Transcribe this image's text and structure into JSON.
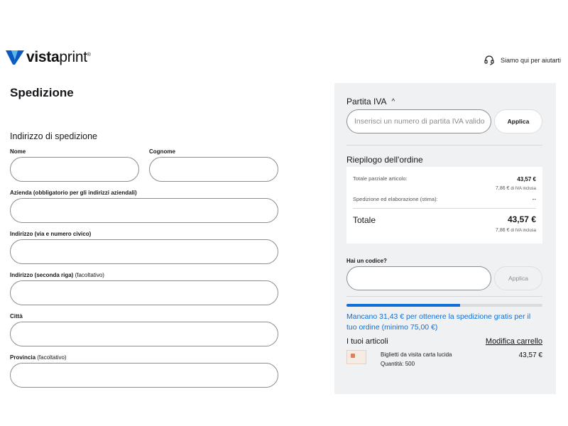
{
  "header": {
    "logo_bold": "vista",
    "logo_light": "print",
    "logo_reg": "®",
    "help_text": "Siamo qui per aiutarti",
    "colors": {
      "logo_blue": "#0a58c2",
      "logo_light_blue": "#58b6e8"
    }
  },
  "shipping": {
    "title": "Spedizione",
    "subhead": "Indirizzo di spedizione",
    "fields": {
      "first_name": {
        "label": "Nome",
        "value": ""
      },
      "last_name": {
        "label": "Cognome",
        "value": ""
      },
      "company": {
        "label": "Azienda (obbligatorio per gli indirizzi aziendali)",
        "value": ""
      },
      "address1": {
        "label": "Indirizzo (via e numero civico)",
        "value": ""
      },
      "address2": {
        "label": "Indirizzo (seconda riga)",
        "optional": "(facoltativo)",
        "value": ""
      },
      "city": {
        "label": "Città",
        "value": ""
      },
      "province": {
        "label": "Provincia",
        "optional": "(facoltativo)",
        "value": ""
      }
    }
  },
  "sidebar": {
    "vat": {
      "title": "Partita IVA",
      "caret": "^",
      "placeholder": "Inserisci un numero di partita IVA valido",
      "apply": "Applica"
    },
    "summary": {
      "title": "Riepilogo dell'ordine",
      "subtotal_label": "Totale parziale articolo:",
      "subtotal_value": "43,57 €",
      "subtotal_vat": "7,86 €",
      "vat_included": "di IVA inclusa",
      "shipping_label": "Spedizione ed elaborazione (stima):",
      "shipping_value": "--",
      "total_label": "Totale",
      "total_value": "43,57 €",
      "total_vat": "7,86 €"
    },
    "promo": {
      "label": "Hai un codice?",
      "value": "",
      "apply": "Applica"
    },
    "free_shipping": {
      "progress": 0.58,
      "message": "Mancano 31,43 € per ottenere la spedizione gratis per il tuo ordine (minimo 75,00 €)",
      "color": "#0f6fd6"
    },
    "items": {
      "title": "I tuoi articoli",
      "edit_label": "Modifica carrello",
      "list": [
        {
          "name": "Biglietti da visita carta lucida",
          "quantity": "Quantità: 500",
          "price": "43,57 €"
        }
      ]
    }
  }
}
